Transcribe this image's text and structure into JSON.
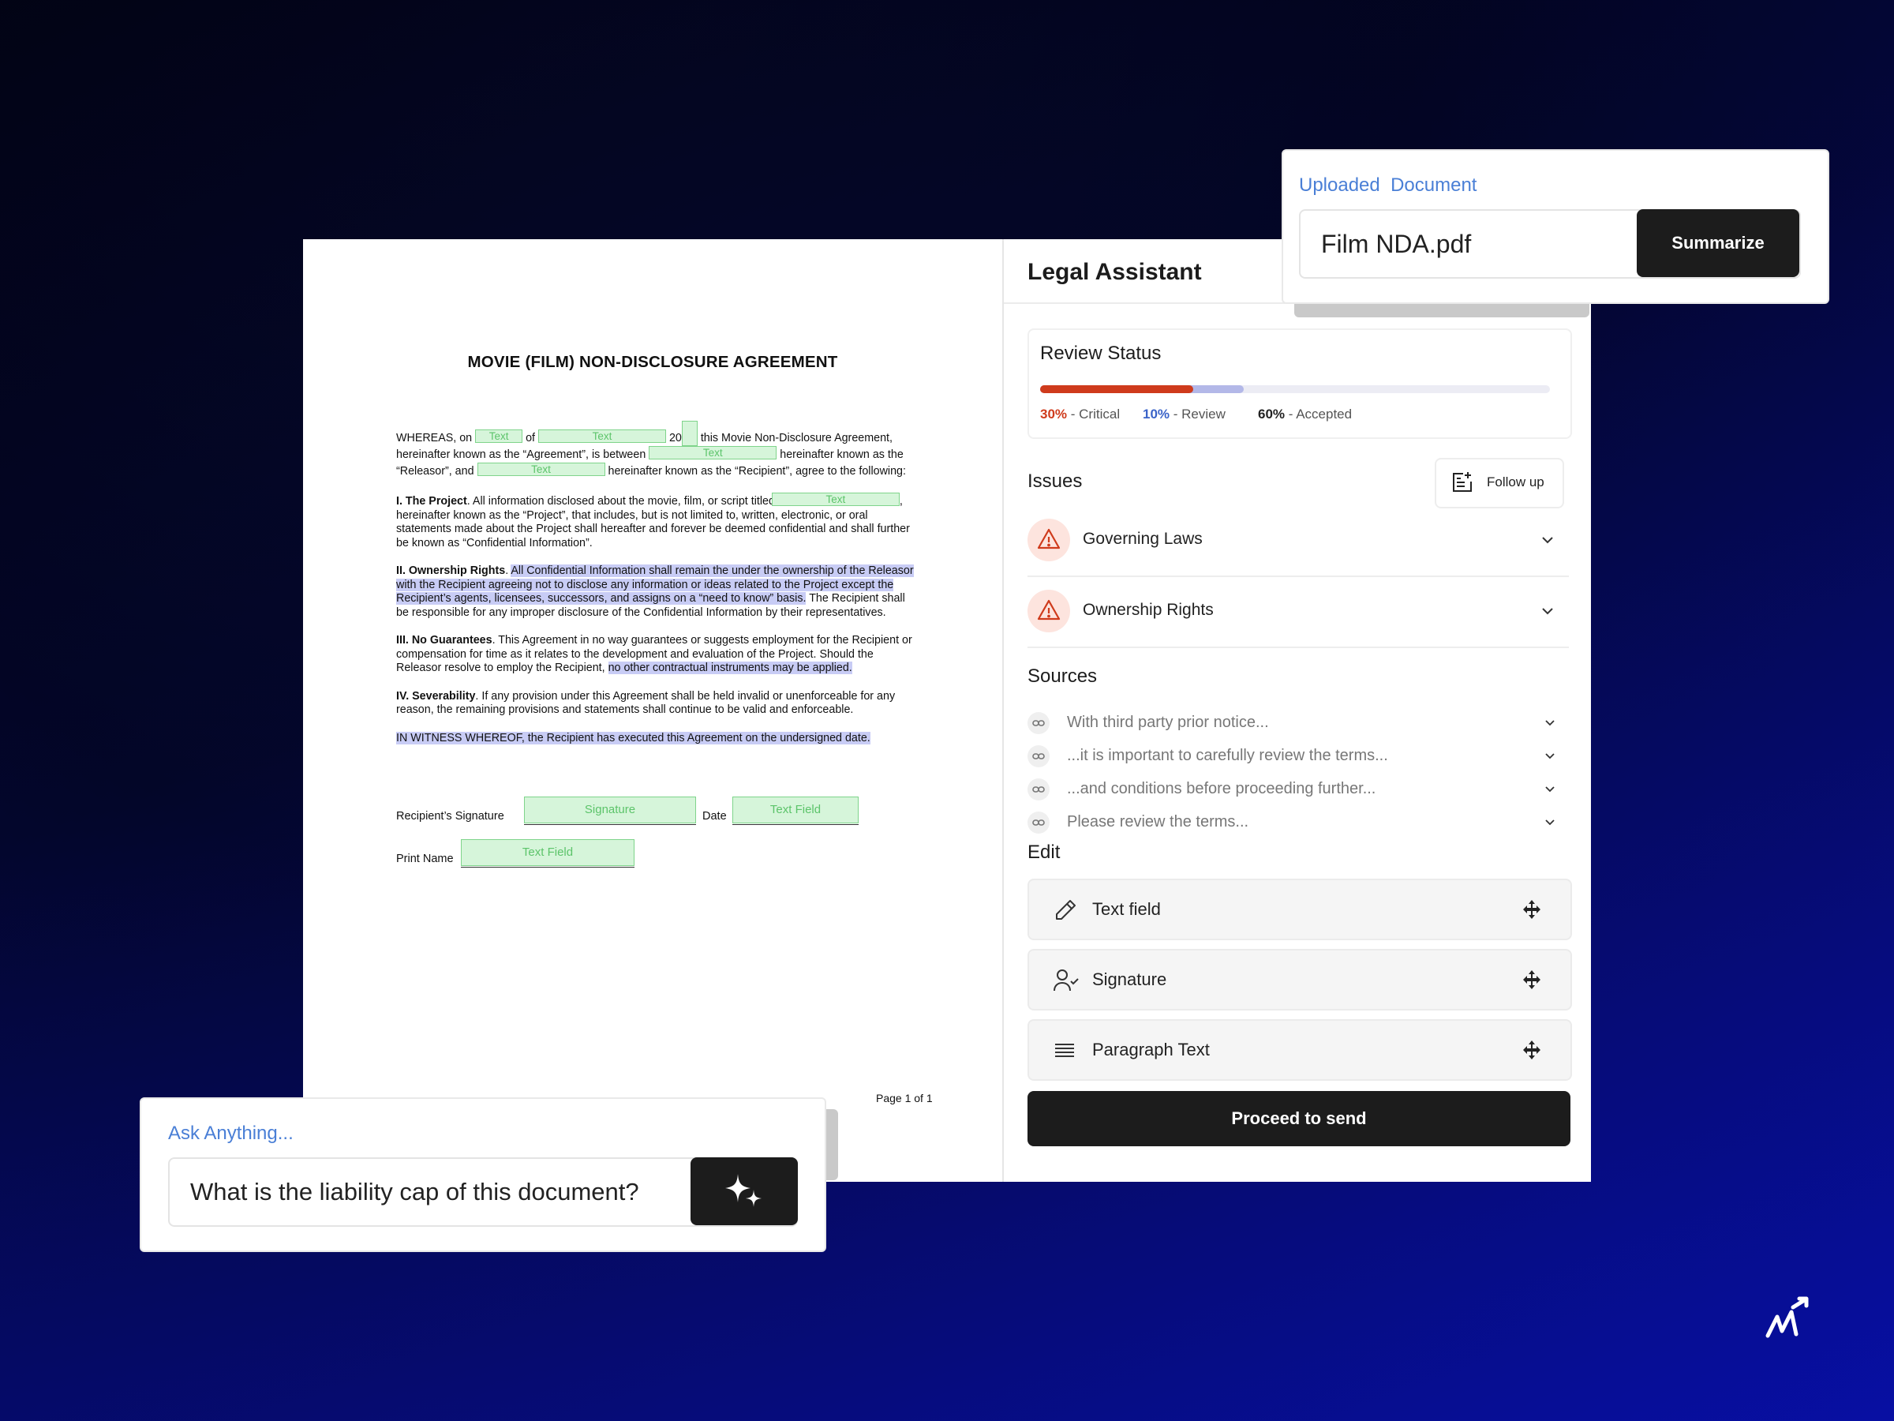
{
  "document": {
    "title": "MOVIE (FILM) NON-DISCLOSURE AGREEMENT",
    "field_text": "Text",
    "p1_a": "WHEREAS, on ",
    "p1_b": " of ",
    "p1_c": " 20",
    "p1_d": " this Movie Non-Disclosure Agreement, hereinafter known as the “Agreement”, is between ",
    "p1_e": " hereinafter known as the “Releasor”, and ",
    "p1_f": " hereinafter known as the “Recipient”, agree to the following:",
    "s1_head": "I. The Project",
    "s1_a": ". All information disclosed about the movie, film, or script titled ",
    "s1_b": ", hereinafter known as the “Project”, that includes, but is not limited to, written, electronic, or oral statements made about the Project shall hereafter and forever be deemed confidential and shall further be known as “Confidential Information”.",
    "s2_head": "II. Ownership Rights",
    "s2_hl": "All Confidential Information shall remain the under the ownership of the Releasor with the Recipient agreeing not to disclose any information or ideas related to the Project except the Recipient’s agents, licensees, successors, and assigns on a “need to know” basis.",
    "s2_rest": " The Recipient shall be responsible for any improper disclosure of the Confidential Information by their representatives.",
    "s3_head": "III. No Guarantees",
    "s3_a": ". This Agreement in no way guarantees or suggests employment for the Recipient or compensation for time as it relates to the development and evaluation of the Project. Should the Releasor resolve to employ the Recipient, ",
    "s3_hl": "no other contractual instruments may be applied.",
    "s4_head": "IV. Severability",
    "s4_a": ". If any provision under this Agreement shall be held invalid or unenforceable for any reason, the remaining provisions and statements shall continue to be valid and enforceable.",
    "witness": "IN WITNESS WHEREOF, the Recipient has executed this Agreement on the undersigned date.",
    "sig_label": "Recipient’s Signature",
    "sig_field": "Signature",
    "date_label": "Date",
    "date_field": "Text Field",
    "print_label": "Print Name",
    "print_field": "Text Field",
    "page": "Page 1 of 1"
  },
  "assistant": {
    "title": "Legal Assistant",
    "review": {
      "title": "Review Status",
      "critical_pct": "30%",
      "critical_label": "- Critical",
      "review_pct": "10%",
      "review_label": "- Review",
      "accepted_pct": "60%",
      "accepted_label": "- Accepted",
      "critical_value": 0.3,
      "review_value": 0.1,
      "accepted_value": 0.6,
      "colors": {
        "critical": "#cf3b1c",
        "review": "#b3b8e8",
        "accepted": "#ececf4"
      }
    },
    "issues": {
      "title": "Issues",
      "follow_up": "Follow up",
      "items": [
        {
          "label": "Governing Laws",
          "icon": "warning-icon"
        },
        {
          "label": "Ownership Rights",
          "icon": "warning-icon"
        }
      ]
    },
    "sources": {
      "title": "Sources",
      "items": [
        {
          "label": "With third party prior notice..."
        },
        {
          "label": "...it is important to carefully review the terms..."
        },
        {
          "label": "...and conditions before proceeding further..."
        },
        {
          "label": "Please review the terms..."
        }
      ]
    },
    "edit": {
      "title": "Edit",
      "items": [
        {
          "label": "Text field",
          "icon": "pencil-icon"
        },
        {
          "label": "Signature",
          "icon": "user-check-icon"
        },
        {
          "label": "Paragraph Text",
          "icon": "lines-icon"
        }
      ]
    },
    "proceed": "Proceed to send"
  },
  "upload": {
    "label": "Uploaded  Document",
    "file": "Film NDA.pdf",
    "button": "Summarize"
  },
  "ask": {
    "label": "Ask Anything...",
    "value": "What is the liability cap of this document?",
    "button_icon": "sparkle-icon"
  }
}
